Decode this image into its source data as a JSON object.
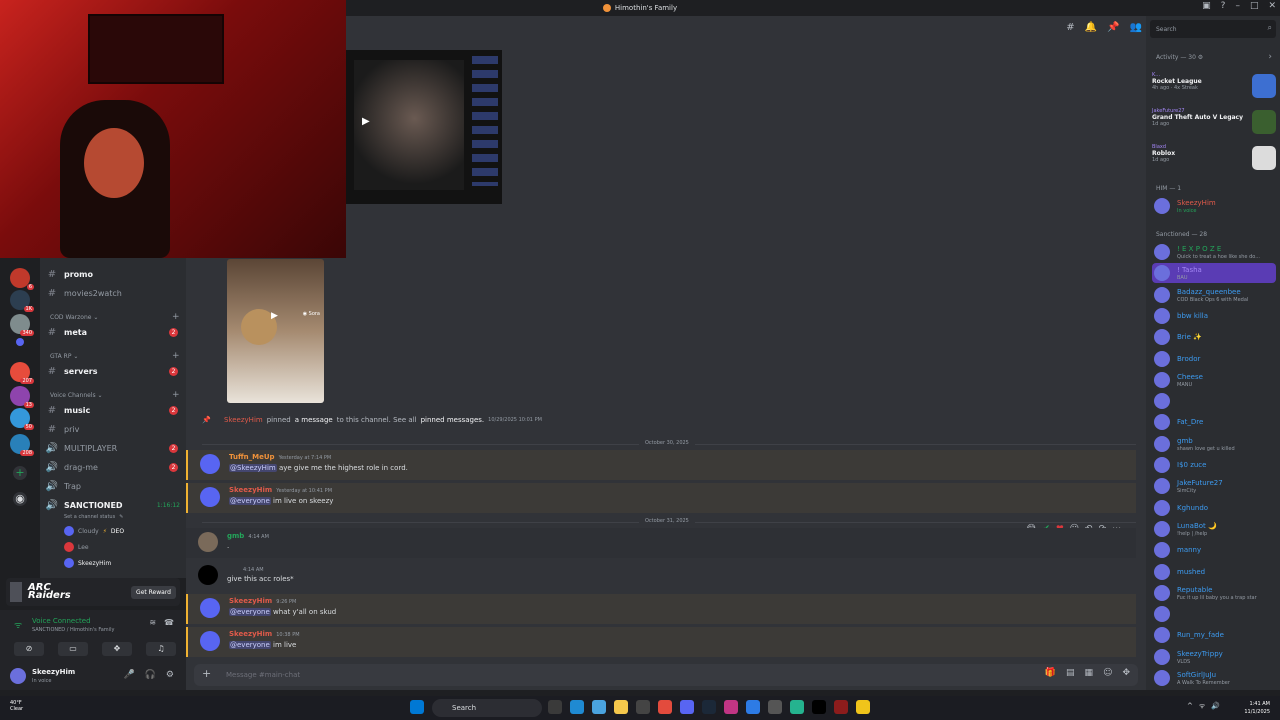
{
  "window": {
    "title": "Himothin's Family"
  },
  "channels": {
    "items": [
      {
        "name": "promo",
        "top": 0
      },
      {
        "name": "movies2watch"
      }
    ],
    "cat_warzone": "COD Warzone",
    "meta": "meta",
    "meta_count": "2",
    "cat_gta": "GTA RP",
    "servers": "servers",
    "servers_count": "2",
    "cat_voice": "Voice Channels",
    "music": "music",
    "music_count": "2",
    "priv": "priv",
    "multiplayer": "MULTIPLAYER",
    "multiplayer_count": "2",
    "dragme": "drag-me",
    "dragme_count": "2",
    "trap": "Trap",
    "sanctioned": "SANCTIONED",
    "sanctioned_timer": "1:16:12",
    "set_status": "Set a channel status",
    "vu1": "Cloudy",
    "vu1_badge": "DEO",
    "vu2": "Lee",
    "vu3": "SkeezyHim"
  },
  "promo": {
    "brand": "ARC Raiders",
    "button": "Get Reward"
  },
  "voice": {
    "status": "Voice Connected",
    "sub": "SANCTIONED / Himothin's Family"
  },
  "user": {
    "name": "SkeezyHim",
    "status": "In voice"
  },
  "messages": {
    "sys_user": "SkeezyHim",
    "sys_pinned": "pinned",
    "sys_amessage": "a message",
    "sys_mid": "to this channel. See all",
    "sys_pinned_messages": "pinned messages.",
    "sys_time": "10/29/2025 10:01 PM",
    "div1": "October 30, 2025",
    "m1_author": "Tuffn_MeUp",
    "m1_time": "Yesterday at 7:14 PM",
    "m1_ping": "@SkeezyHim",
    "m1_text": " aye give me the highest role in cord.",
    "m2_author": "SkeezyHim",
    "m2_time": "Yesterday at 10:41 PM",
    "m2_ping": "@everyone",
    "m2_text": " im live on skeezy",
    "div2": "October 31, 2025",
    "m3_author": "gmb",
    "m3_time": "4:14 AM",
    "m3_text": ".",
    "m4_time": "4:14 AM",
    "m4_text": "give this acc roles*",
    "m5_author": "SkeezyHim",
    "m5_time": "9:26 PM",
    "m5_ping": "@everyone",
    "m5_text": " what y'all on skud",
    "m6_author": "SkeezyHim",
    "m6_time": "10:38 PM",
    "m6_ping": "@everyone",
    "m6_text": " im live"
  },
  "composer": {
    "placeholder": "Message #main-chat"
  },
  "members": {
    "search_placeholder": "Search",
    "activity_head": "Activity — 30",
    "activities": [
      {
        "who": "K...",
        "game": "Rocket League",
        "meta": "4h ago · 4x Streak"
      },
      {
        "who": "JakeFuture27",
        "game": "Grand Theft Auto V Legacy",
        "meta": "1d ago"
      },
      {
        "who": "Blaxd",
        "game": "Roblox",
        "meta": "1d ago"
      }
    ],
    "him_head": "HIM — 1",
    "him": {
      "name": "SkeezyHim",
      "status": "In voice"
    },
    "sanctioned_head": "Sanctioned — 28",
    "list": [
      {
        "name": "! E X P O Z E",
        "status": "Quick to treat a hoe like she do..."
      },
      {
        "name": "! Tasha",
        "status": "BAU"
      },
      {
        "name": "Badazz_queenbee",
        "status": "COD Black Ops 6 with Medal"
      },
      {
        "name": "bbw killa",
        "status": ""
      },
      {
        "name": "Brie ✨",
        "status": ""
      },
      {
        "name": "Brodor",
        "status": ""
      },
      {
        "name": "Cheese",
        "status": "MANU"
      },
      {
        "name": "",
        "status": ""
      },
      {
        "name": "Fat_Dre",
        "status": ""
      },
      {
        "name": "gmb",
        "status": "shawn love get u killed"
      },
      {
        "name": "I$0 zuce",
        "status": ""
      },
      {
        "name": "JakeFuture27",
        "status": "SimCity"
      },
      {
        "name": "Kghundo",
        "status": ""
      },
      {
        "name": "LunaBot 🌙",
        "status": "!help | /help"
      },
      {
        "name": "manny",
        "status": ""
      },
      {
        "name": "mushed",
        "status": ""
      },
      {
        "name": "Reputable",
        "status": "Fuc it up lil baby you a trap star"
      },
      {
        "name": "",
        "status": ""
      },
      {
        "name": "Run_my_fade",
        "status": ""
      },
      {
        "name": "SkeezyTrippy",
        "status": "VLDS"
      },
      {
        "name": "SoftGirlJuJu",
        "status": "A Walk To Remember"
      }
    ]
  },
  "taskbar": {
    "temp": "40°F",
    "cond": "Clear",
    "search": "Search",
    "time": "1:41 AM",
    "date": "11/1/2025"
  },
  "colors": {
    "accent": "#5865f2",
    "mention": "#da373c",
    "online": "#23a55a",
    "username_red": "#e05a4a"
  }
}
